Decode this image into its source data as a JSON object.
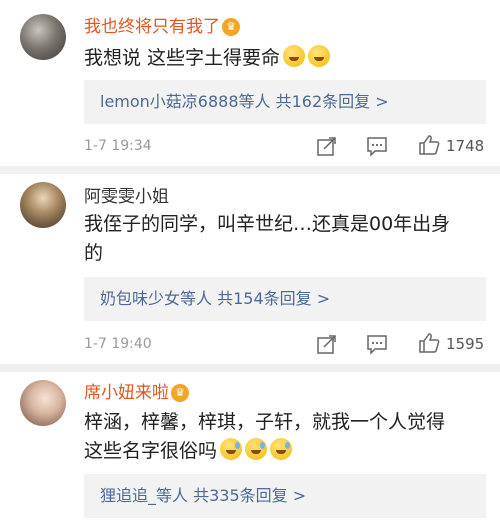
{
  "comments": [
    {
      "username": "我也终将只有我了",
      "text": "我想说 这些字土得要命",
      "replies_users": "lemon小菇凉6888等人",
      "replies_total": "共162条回复 >",
      "time": "1-7 19:34",
      "likes": "1748"
    },
    {
      "username": "阿雯雯小姐",
      "text_line1": "我侄子的同学，叫辛世纪…还真是00年出身",
      "text_line2": "的",
      "replies_users": "奶包味少女等人",
      "replies_total": "共154条回复 >",
      "time": "1-7 19:40",
      "likes": "1595"
    },
    {
      "username": "席小妞来啦",
      "text_line1": "梓涵，梓馨，梓琪，子轩，就我一个人觉得",
      "text_line2": "这些名字很俗吗",
      "replies_users": "狸追追_等人",
      "replies_total": "共335条回复 >"
    }
  ],
  "icons": [
    "avatar",
    "vip-crown-icon",
    "emoji-icon",
    "repost-icon",
    "comment-icon",
    "like-icon"
  ],
  "colors": {
    "vip_name": "#e2561f",
    "reply_link": "#4c6a95",
    "reply_bg": "#f2f2f2",
    "divider": "#f0f0f0"
  }
}
